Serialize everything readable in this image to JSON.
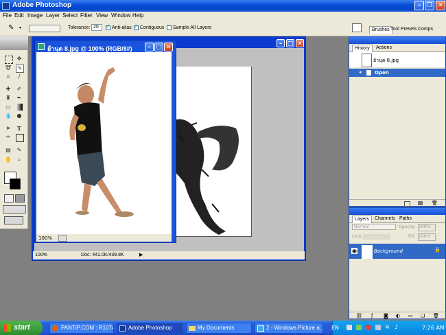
{
  "app": {
    "title": "Adobe Photoshop"
  },
  "menu": [
    "File",
    "Edit",
    "Image",
    "Layer",
    "Select",
    "Filter",
    "View",
    "Window",
    "Help"
  ],
  "options": {
    "tolerance_label": "Tolerance:",
    "tolerance_value": "20",
    "anti_alias": "Anti-alias",
    "contiguous": "Contiguous",
    "sample_all_layers": "Sample All Layers"
  },
  "palette_well": {
    "tabs": [
      "Brushes",
      "Tool Presets",
      "Comps"
    ]
  },
  "front_window": {
    "title": "ย้านุต 8.jpg @ 100% (RGB/8#)",
    "zoom": "100%"
  },
  "back_window": {
    "zoom": "100%",
    "doc_info": "Doc: 441.0K/439.8K"
  },
  "history_panel": {
    "tabs": [
      "History",
      "Actions"
    ],
    "snapshot": "ย้านุต 8.jpg",
    "step": "Open"
  },
  "layers_panel": {
    "tabs": [
      "Layers",
      "Channels",
      "Paths"
    ],
    "blend_mode": "Normal",
    "opacity_label": "Opacity:",
    "opacity_value": "100%",
    "lock_label": "Lock:",
    "fill_label": "Fill:",
    "fill_value": "100%",
    "layer_name": "Background"
  },
  "taskbar": {
    "start": "start",
    "tasks": [
      "PANTIP.COM : R1074...",
      "Adobe Photoshop",
      "My Documents",
      "2 - Windows Picture a..."
    ],
    "lang": "EN",
    "clock": "7:26 AM"
  },
  "colors": {
    "titlebar": "#0a4fd9",
    "selected_row": "#3169c6",
    "taskbar": "#245edb"
  }
}
